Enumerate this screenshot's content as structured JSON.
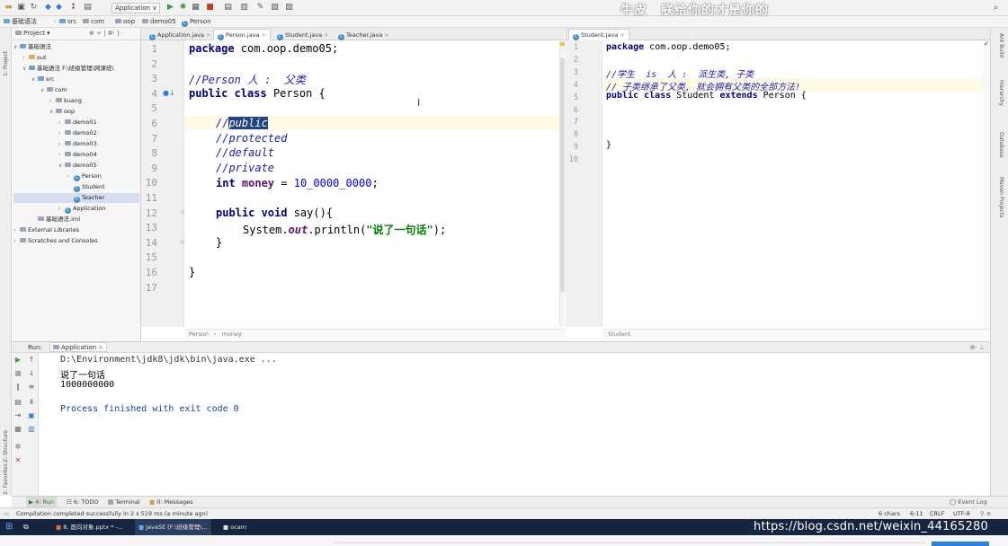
{
  "toolbar": {
    "run_config": "Application ∨",
    "watermark": "牛皮　朕给你的才是你的"
  },
  "breadcrumb": [
    "基础语法",
    "src",
    "com",
    "oop",
    "demo05",
    "Person"
  ],
  "project_panel": {
    "header": "Project ▾",
    "tree": [
      {
        "label": "基础语法",
        "indent": 0,
        "arrow": "∨",
        "type": "module"
      },
      {
        "label": "out",
        "indent": 1,
        "arrow": "›",
        "type": "folder"
      },
      {
        "label": "基础语法 F:\\班级管理\\网课班\\",
        "indent": 1,
        "arrow": "∨",
        "type": "module"
      },
      {
        "label": "src",
        "indent": 2,
        "arrow": "∨",
        "type": "src"
      },
      {
        "label": "com",
        "indent": 3,
        "arrow": "∨",
        "type": "pkg"
      },
      {
        "label": "kuang",
        "indent": 4,
        "arrow": "›",
        "type": "pkg"
      },
      {
        "label": "oop",
        "indent": 4,
        "arrow": "∨",
        "type": "pkg"
      },
      {
        "label": "demo01",
        "indent": 5,
        "arrow": "›",
        "type": "pkg"
      },
      {
        "label": "demo02",
        "indent": 5,
        "arrow": "›",
        "type": "pkg"
      },
      {
        "label": "demo03",
        "indent": 5,
        "arrow": "›",
        "type": "pkg"
      },
      {
        "label": "demo04",
        "indent": 5,
        "arrow": "›",
        "type": "pkg"
      },
      {
        "label": "demo05",
        "indent": 5,
        "arrow": "∨",
        "type": "pkg"
      },
      {
        "label": "Person",
        "indent": 6,
        "arrow": "›",
        "type": "class"
      },
      {
        "label": "Student",
        "indent": 6,
        "arrow": "",
        "type": "class"
      },
      {
        "label": "Teacher",
        "indent": 6,
        "arrow": "",
        "type": "class",
        "selected": true
      },
      {
        "label": "Application",
        "indent": 5,
        "arrow": "›",
        "type": "class"
      },
      {
        "label": "基础语法.iml",
        "indent": 2,
        "arrow": "",
        "type": "file"
      },
      {
        "label": "External Libraries",
        "indent": 0,
        "arrow": "›",
        "type": "lib"
      },
      {
        "label": "Scratches and Consoles",
        "indent": 0,
        "arrow": "›",
        "type": "lib"
      }
    ]
  },
  "left_strip": {
    "project_label": "1: Project",
    "structure_label": "Z: Structure",
    "favorites_label": "2: Favorites"
  },
  "right_strip": {
    "ant_label": "Ant Build",
    "hier_label": "Hierarchy",
    "db_label": "Database",
    "maven_label": "Maven Projects"
  },
  "editor_tabs": [
    {
      "label": "Application.java",
      "active": false
    },
    {
      "label": "Person.java",
      "active": true
    },
    {
      "label": "Student.java",
      "active": false
    },
    {
      "label": "Teacher.java",
      "active": false
    }
  ],
  "right_tab": "Student.java",
  "person_code": {
    "line_numbers": [
      "1",
      "2",
      "3",
      "4",
      "5",
      "6",
      "7",
      "8",
      "9",
      "10",
      "11",
      "12",
      "13",
      "14",
      "15",
      "16",
      "17"
    ],
    "l1_kw": "package",
    "l1_rest": " com.oop.demo05;",
    "l3": "//Person 人 :  父类",
    "l4_kw1": "public",
    "l4_kw2": " class",
    "l4_rest": " Person {",
    "l6_pre": "//",
    "l6_sel": "public",
    "l7": "//protected",
    "l8": "//default",
    "l9": "//private",
    "l10_kw": "int",
    "l10_field": " money",
    "l10_eq": " = ",
    "l10_num": "10_0000_0000",
    "l10_end": ";",
    "l12_kw1": "public",
    "l12_kw2": " void",
    "l12_rest": " say(){",
    "l13_pre": "System.",
    "l13_out": "out",
    "l13_mid": ".println(",
    "l13_str": "\"说了一句话\"",
    "l13_end": ");",
    "l14": "}",
    "l16": "}"
  },
  "person_breadcrumb": {
    "a": "Person",
    "sep": "›",
    "b": "money"
  },
  "student_code": {
    "line_numbers": [
      "1",
      "2",
      "3",
      "4",
      "5",
      "6",
      "7",
      "8",
      "9",
      "10"
    ],
    "l1_kw": "package",
    "l1_rest": " com.oop.demo05;",
    "l3": "//学生  is  人 :  派生类, 子类",
    "l4": "// 子类继承了父类, 就会拥有父类的全部方法!",
    "l5_kw1": "public",
    "l5_kw2": " class",
    "l5_mid": " Student",
    "l5_kw3": " extends",
    "l5_rest": " Person {",
    "l9": "}"
  },
  "student_breadcrumb": "Student",
  "run_panel": {
    "run_label": "Run:",
    "tab_label": "Application",
    "console_lines": [
      "D:\\Environment\\jdk8\\jdk\\bin\\java.exe ...",
      "说了一句话",
      "1000000000",
      "",
      "Process finished with exit code 0"
    ]
  },
  "tool_tabs": [
    {
      "label": "▶ 4: Run",
      "active": true
    },
    {
      "label": "6: TODO",
      "active": false
    },
    {
      "label": "Terminal",
      "active": false
    },
    {
      "label": "0: Messages",
      "active": false
    }
  ],
  "event_log": "Event Log",
  "status": {
    "message": "Compilation completed successfully in 2 s 519 ms (a minute ago)",
    "chars": "6 chars",
    "pos": "6:11",
    "crlf": "CRLF",
    "enc": "UTF-8"
  },
  "taskbar": {
    "items": [
      {
        "label": "8. 面向对象.pptx * -..."
      },
      {
        "label": "JavaSE [F:\\班级管理\\..."
      },
      {
        "label": "ocam"
      }
    ],
    "blog": "https://blog.csdn.net/weixin_44165280"
  }
}
